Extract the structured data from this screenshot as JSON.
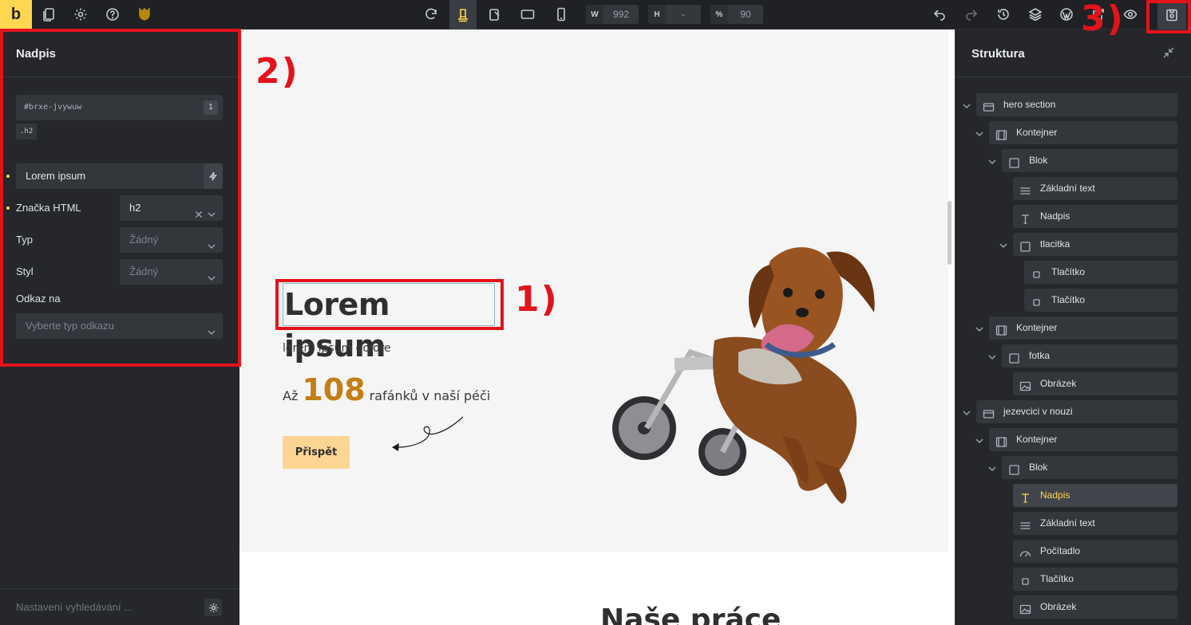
{
  "toolbar": {
    "logo": "b",
    "width_label": "W",
    "width_value": "992",
    "height_label": "H",
    "height_value": "-",
    "zoom_label": "%",
    "zoom_value": "90"
  },
  "left_panel": {
    "title": "Nadpis",
    "element_id": "#brxe-jvywuw",
    "id_badge": "1",
    "css_class": ".h2",
    "text_value": "Lorem ipsum",
    "html_tag_label": "Značka HTML",
    "html_tag_value": "h2",
    "type_label": "Typ",
    "type_value": "Žádný",
    "style_label": "Styl",
    "style_value": "Žádný",
    "link_label": "Odkaz na",
    "link_placeholder": "Vyberte typ odkazu",
    "seo_label": "Nastavení vyhledávání ..."
  },
  "canvas": {
    "hero_title": "Lorem ipsum",
    "hero_subtitle": "lorem ipsum dolore",
    "counter_prefix": "Až",
    "counter_number": "108",
    "counter_suffix": "rafánků v naší péči",
    "donate_button": "Přispět",
    "section2_title": "Naše práce"
  },
  "annotations": {
    "mark1": "1)",
    "mark2": "2)",
    "mark3": "3)",
    "color": "#e3131b"
  },
  "right_panel": {
    "title": "Struktura",
    "tree": [
      {
        "label": "hero section",
        "icon": "section-icon"
      },
      {
        "label": "Kontejner",
        "icon": "container-icon"
      },
      {
        "label": "Blok",
        "icon": "block-icon"
      },
      {
        "label": "Základní text",
        "icon": "text-lines-icon"
      },
      {
        "label": "Nadpis",
        "icon": "heading-icon"
      },
      {
        "label": "tlacitka",
        "icon": "block-icon"
      },
      {
        "label": "Tlačítko",
        "icon": "button-icon"
      },
      {
        "label": "Tlačítko",
        "icon": "button-icon"
      },
      {
        "label": "Kontejner",
        "icon": "container-icon"
      },
      {
        "label": "fotka",
        "icon": "block-icon"
      },
      {
        "label": "Obrázek",
        "icon": "image-icon"
      },
      {
        "label": "jezevcici v nouzi",
        "icon": "section-icon"
      },
      {
        "label": "Kontejner",
        "icon": "container-icon"
      },
      {
        "label": "Blok",
        "icon": "block-icon"
      },
      {
        "label": "Nadpis",
        "icon": "heading-icon"
      },
      {
        "label": "Základní text",
        "icon": "text-lines-icon"
      },
      {
        "label": "Počítadlo",
        "icon": "counter-icon"
      },
      {
        "label": "Tlačítko",
        "icon": "button-icon"
      },
      {
        "label": "Obrázek",
        "icon": "image-icon"
      }
    ]
  },
  "colors": {
    "accent": "#ffd64f",
    "counter_number": "#c47e15",
    "donate_bg": "#fcd593"
  }
}
